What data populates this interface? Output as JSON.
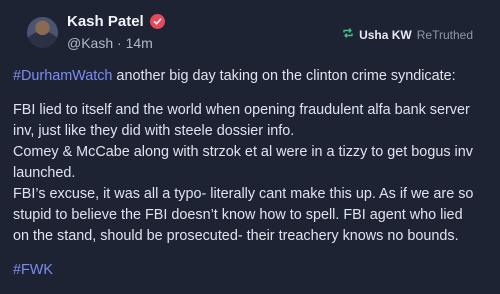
{
  "post": {
    "author_name": "Kash Patel",
    "handle": "@Kash",
    "time": "14m",
    "retruth_user": "Usha KW",
    "retruth_label": "ReTruthed",
    "hashtag_top": "#DurhamWatch",
    "intro_text": " another big day taking on the clinton crime syndicate:",
    "body_lines": [
      "FBI lied to itself and the world when opening fraudulent alfa bank server",
      "inv, just like they did with steele dossier info.",
      "Comey & McCabe along with strzok et al were in a tizzy to get bogus inv",
      "launched.",
      "FBI’s excuse, it was all a typo- literally cant make this up. As if we are so",
      "stupid to believe the FBI doesn’t know how to spell. FBI agent who lied",
      "on the stand, should be prosecuted- their treachery knows no bounds."
    ],
    "hashtag_bottom": "#FWK"
  },
  "colors": {
    "background": "#1e2333",
    "hashtag": "#7c8cf0",
    "verified_badge": "#e64a5a",
    "retruth_icon": "#3fbf8a"
  },
  "icons": {
    "verified": "verified-badge-icon",
    "retruth": "retruth-icon"
  }
}
